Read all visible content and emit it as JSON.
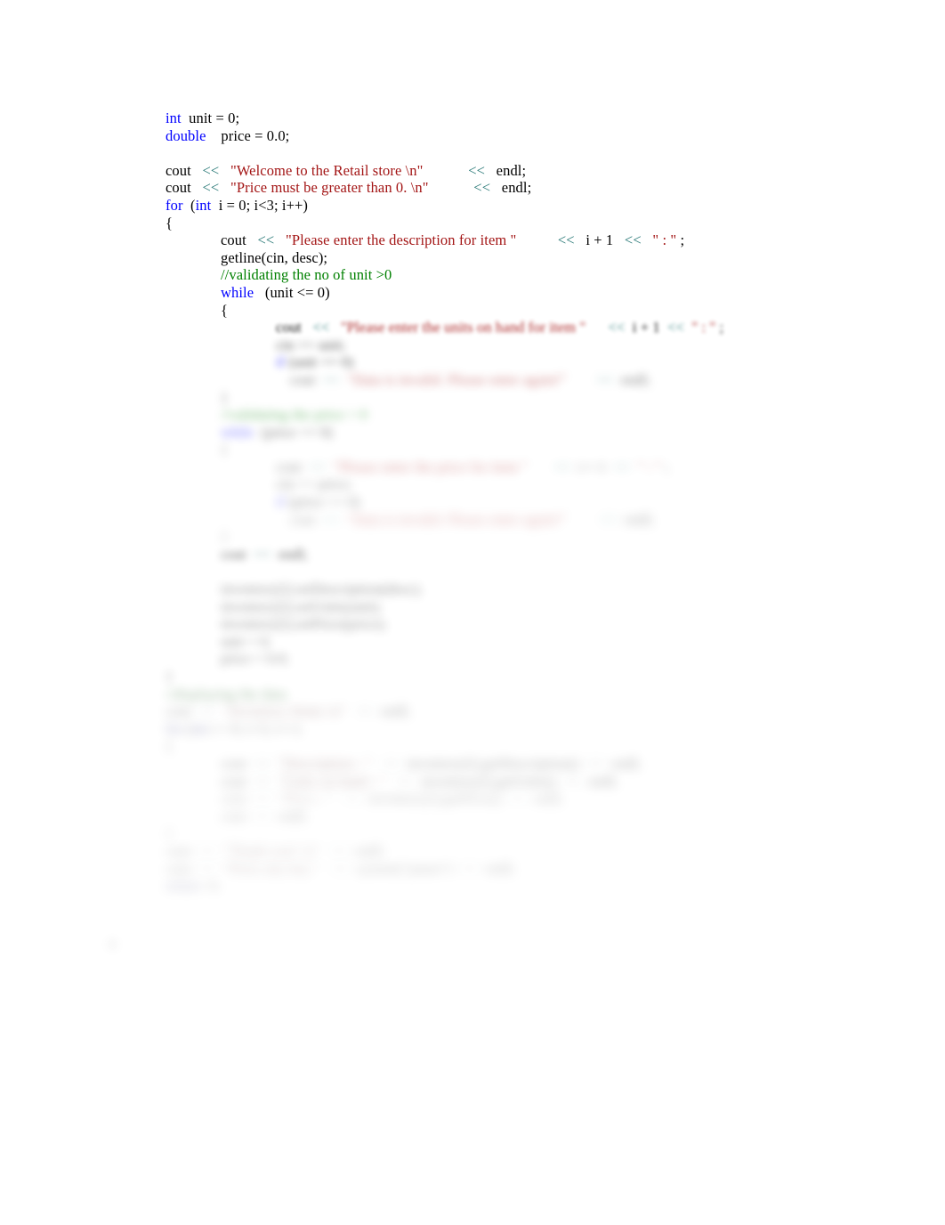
{
  "document": {
    "kind": "source-code-listing",
    "language": "C++",
    "page_background": "#ffffff",
    "margin_mark": "[]"
  },
  "palette": {
    "keyword": "#0000ff",
    "string": "#a31515",
    "comment": "#008000",
    "operator": "#2b7a78",
    "plain": "#000000",
    "background": "#ffffff"
  },
  "code": {
    "lines": [
      {
        "id": "l1",
        "indent": 0,
        "blur": "b0",
        "tokens": [
          {
            "t": "int",
            "c": "kw"
          },
          {
            "t": "  unit = 0;",
            "c": "pln"
          }
        ]
      },
      {
        "id": "l2",
        "indent": 0,
        "blur": "b0",
        "tokens": [
          {
            "t": "double",
            "c": "kw"
          },
          {
            "t": "    price = 0.0;",
            "c": "pln"
          }
        ]
      },
      {
        "id": "l3",
        "indent": 0,
        "blur": "b0",
        "tokens": []
      },
      {
        "id": "l4",
        "indent": 0,
        "blur": "b0",
        "tokens": [
          {
            "t": "cout   ",
            "c": "pln"
          },
          {
            "t": "<<",
            "c": "op"
          },
          {
            "t": "   ",
            "c": "pln"
          },
          {
            "t": "\"Welcome to the Retail store \\n\"",
            "c": "str"
          },
          {
            "t": "            ",
            "c": "pln"
          },
          {
            "t": "<<",
            "c": "op"
          },
          {
            "t": "   endl;",
            "c": "pln"
          }
        ]
      },
      {
        "id": "l5",
        "indent": 0,
        "blur": "b0",
        "tokens": [
          {
            "t": "cout   ",
            "c": "pln"
          },
          {
            "t": "<<",
            "c": "op"
          },
          {
            "t": "   ",
            "c": "pln"
          },
          {
            "t": "\"Price must be greater than 0. \\n\"",
            "c": "str"
          },
          {
            "t": "            ",
            "c": "pln"
          },
          {
            "t": "<<",
            "c": "op"
          },
          {
            "t": "   endl;",
            "c": "pln"
          }
        ]
      },
      {
        "id": "l6",
        "indent": 0,
        "blur": "b0",
        "tokens": [
          {
            "t": "for",
            "c": "kw"
          },
          {
            "t": "  (",
            "c": "pln"
          },
          {
            "t": "int",
            "c": "kw"
          },
          {
            "t": "  i = 0; i<3; i++)",
            "c": "pln"
          }
        ]
      },
      {
        "id": "l7",
        "indent": 0,
        "blur": "b0",
        "tokens": [
          {
            "t": "{",
            "c": "pln"
          }
        ]
      },
      {
        "id": "l8",
        "indent": 4,
        "blur": "b0",
        "tokens": [
          {
            "t": "cout   ",
            "c": "pln"
          },
          {
            "t": "<<",
            "c": "op"
          },
          {
            "t": "   ",
            "c": "pln"
          },
          {
            "t": "\"Please enter the description for item \"",
            "c": "str"
          },
          {
            "t": "           ",
            "c": "pln"
          },
          {
            "t": "<<",
            "c": "op"
          },
          {
            "t": "   i + 1   ",
            "c": "pln"
          },
          {
            "t": "<<",
            "c": "op"
          },
          {
            "t": "   ",
            "c": "pln"
          },
          {
            "t": "\" : \"",
            "c": "str"
          },
          {
            "t": " ;",
            "c": "pln"
          }
        ]
      },
      {
        "id": "l9",
        "indent": 4,
        "blur": "b0",
        "tokens": [
          {
            "t": "getline(cin, desc);",
            "c": "pln"
          }
        ]
      },
      {
        "id": "l10",
        "indent": 4,
        "blur": "b0",
        "tokens": [
          {
            "t": "//validating the no of unit >0",
            "c": "cmt"
          }
        ]
      },
      {
        "id": "l11",
        "indent": 4,
        "blur": "b0",
        "tokens": [
          {
            "t": "while",
            "c": "kw"
          },
          {
            "t": "   (unit <= 0)",
            "c": "pln"
          }
        ]
      },
      {
        "id": "l12",
        "indent": 4,
        "blur": "b0",
        "tokens": [
          {
            "t": "{",
            "c": "pln"
          }
        ]
      },
      {
        "id": "l13",
        "indent": 8,
        "blur": "b1",
        "tokens": [
          {
            "t": "cout   ",
            "c": "pln"
          },
          {
            "t": "<<",
            "c": "op"
          },
          {
            "t": "   ",
            "c": "pln"
          },
          {
            "t": "\"Please enter the units on hand for item \"",
            "c": "str"
          },
          {
            "t": "      ",
            "c": "pln"
          },
          {
            "t": "<<",
            "c": "op"
          },
          {
            "t": "  i + 1  ",
            "c": "pln"
          },
          {
            "t": "<<",
            "c": "op"
          },
          {
            "t": "  ",
            "c": "pln"
          },
          {
            "t": "\" : \"",
            "c": "str"
          },
          {
            "t": " ;",
            "c": "pln"
          }
        ]
      },
      {
        "id": "l14",
        "indent": 8,
        "blur": "b3",
        "tokens": [
          {
            "t": "cin >> unit;",
            "c": "pln"
          }
        ]
      },
      {
        "id": "l15",
        "indent": 8,
        "blur": "b3",
        "tokens": [
          {
            "t": "if",
            "c": "kw"
          },
          {
            "t": " (unit <= 0)",
            "c": "pln"
          }
        ]
      },
      {
        "id": "l16",
        "indent": 9,
        "blur": "b4",
        "tokens": [
          {
            "t": "cout  ",
            "c": "pln"
          },
          {
            "t": "<<",
            "c": "op"
          },
          {
            "t": "  ",
            "c": "pln"
          },
          {
            "t": "\"Data is invalid. Please enter again!\"",
            "c": "str"
          },
          {
            "t": "        ",
            "c": "pln"
          },
          {
            "t": "<<",
            "c": "op"
          },
          {
            "t": "  endl;",
            "c": "pln"
          }
        ]
      },
      {
        "id": "l17",
        "indent": 4,
        "blur": "b4",
        "tokens": [
          {
            "t": "}",
            "c": "pln"
          }
        ]
      },
      {
        "id": "l18",
        "indent": 4,
        "blur": "b4",
        "tokens": [
          {
            "t": "//validating the price > 0",
            "c": "cmt"
          }
        ]
      },
      {
        "id": "l19",
        "indent": 4,
        "blur": "b4",
        "tokens": [
          {
            "t": "while",
            "c": "kw"
          },
          {
            "t": "  (price <= 0)",
            "c": "pln"
          }
        ]
      },
      {
        "id": "l20",
        "indent": 4,
        "blur": "b5",
        "tokens": [
          {
            "t": "{",
            "c": "pln"
          }
        ]
      },
      {
        "id": "l21",
        "indent": 8,
        "blur": "b5",
        "tokens": [
          {
            "t": "cout  ",
            "c": "pln"
          },
          {
            "t": "<<",
            "c": "op"
          },
          {
            "t": "  ",
            "c": "pln"
          },
          {
            "t": "\"Please enter the price for item \"",
            "c": "str"
          },
          {
            "t": "       ",
            "c": "pln"
          },
          {
            "t": "<<",
            "c": "op"
          },
          {
            "t": "  i + 1  ",
            "c": "pln"
          },
          {
            "t": "<<",
            "c": "op"
          },
          {
            "t": "  ",
            "c": "pln"
          },
          {
            "t": "\" : \"",
            "c": "str"
          },
          {
            "t": " ;",
            "c": "pln"
          }
        ]
      },
      {
        "id": "l22",
        "indent": 8,
        "blur": "b5",
        "tokens": [
          {
            "t": "cin >> price;",
            "c": "pln"
          }
        ]
      },
      {
        "id": "l23",
        "indent": 8,
        "blur": "b5",
        "tokens": [
          {
            "t": "if",
            "c": "kw"
          },
          {
            "t": " (price <= 0)",
            "c": "pln"
          }
        ]
      },
      {
        "id": "l24",
        "indent": 9,
        "blur": "b6",
        "tokens": [
          {
            "t": "cout  ",
            "c": "pln"
          },
          {
            "t": "<<",
            "c": "op"
          },
          {
            "t": "  ",
            "c": "pln"
          },
          {
            "t": "\"Data is invalid. Please enter again!\"",
            "c": "str"
          },
          {
            "t": "         ",
            "c": "pln"
          },
          {
            "t": "<<",
            "c": "op"
          },
          {
            "t": "  endl;",
            "c": "pln"
          }
        ]
      },
      {
        "id": "l25",
        "indent": 4,
        "blur": "b6",
        "tokens": [
          {
            "t": "}",
            "c": "pln"
          }
        ]
      },
      {
        "id": "l26",
        "indent": 4,
        "blur": "g2",
        "tokens": [
          {
            "t": "cout  ",
            "c": "pln"
          },
          {
            "t": "<<",
            "c": "op"
          },
          {
            "t": "  endl;",
            "c": "pln"
          }
        ]
      },
      {
        "id": "l27",
        "indent": 0,
        "blur": "g2",
        "tokens": []
      },
      {
        "id": "l28",
        "indent": 4,
        "blur": "g3",
        "tokens": [
          {
            "t": "inventory[i].setDescription(desc);",
            "c": "pln"
          }
        ]
      },
      {
        "id": "l29",
        "indent": 4,
        "blur": "g3",
        "tokens": [
          {
            "t": "inventory[i].setUnits(unit);",
            "c": "pln"
          }
        ]
      },
      {
        "id": "l30",
        "indent": 4,
        "blur": "g3",
        "tokens": [
          {
            "t": "inventory[i].setPrice(price);",
            "c": "pln"
          }
        ]
      },
      {
        "id": "l31",
        "indent": 4,
        "blur": "g3",
        "tokens": [
          {
            "t": "unit = 0;",
            "c": "pln"
          }
        ]
      },
      {
        "id": "l32",
        "indent": 4,
        "blur": "g3",
        "tokens": [
          {
            "t": "price = 0.0;",
            "c": "pln"
          }
        ]
      },
      {
        "id": "l33",
        "indent": 0,
        "blur": "g3",
        "tokens": [
          {
            "t": "}",
            "c": "pln"
          }
        ]
      },
      {
        "id": "l34",
        "indent": 0,
        "blur": "g3",
        "tokens": [
          {
            "t": "//displaying the data",
            "c": "cmt"
          }
        ]
      },
      {
        "id": "l35",
        "indent": 0,
        "blur": "g4",
        "tokens": [
          {
            "t": "cout  ",
            "c": "pln"
          },
          {
            "t": "<<",
            "c": "op"
          },
          {
            "t": "  ",
            "c": "pln"
          },
          {
            "t": "\"Inventory Items \\n\"",
            "c": "str"
          },
          {
            "t": "   ",
            "c": "pln"
          },
          {
            "t": "<<",
            "c": "op"
          },
          {
            "t": "  endl;",
            "c": "pln"
          }
        ]
      },
      {
        "id": "l36",
        "indent": 0,
        "blur": "g4",
        "tokens": [
          {
            "t": "for",
            "c": "kw"
          },
          {
            "t": " (",
            "c": "pln"
          },
          {
            "t": "int",
            "c": "kw"
          },
          {
            "t": " i = 0; i<3; i++)",
            "c": "pln"
          }
        ]
      },
      {
        "id": "l37",
        "indent": 0,
        "blur": "g4",
        "tokens": [
          {
            "t": "{",
            "c": "pln"
          }
        ]
      },
      {
        "id": "l38",
        "indent": 4,
        "blur": "g4",
        "tokens": [
          {
            "t": "cout  ",
            "c": "pln"
          },
          {
            "t": "<<",
            "c": "op"
          },
          {
            "t": "  ",
            "c": "pln"
          },
          {
            "t": "\"Description : \"",
            "c": "str"
          },
          {
            "t": "   ",
            "c": "pln"
          },
          {
            "t": "<<",
            "c": "op"
          },
          {
            "t": "  inventory[i].getDescription()",
            "c": "pln"
          },
          {
            "t": "  ",
            "c": "pln"
          },
          {
            "t": "<<",
            "c": "op"
          },
          {
            "t": "  endl;",
            "c": "pln"
          }
        ]
      },
      {
        "id": "l39",
        "indent": 4,
        "blur": "g4",
        "tokens": [
          {
            "t": "cout  ",
            "c": "pln"
          },
          {
            "t": "<<",
            "c": "op"
          },
          {
            "t": "  ",
            "c": "pln"
          },
          {
            "t": "\"Units on hand : \"",
            "c": "str"
          },
          {
            "t": "   ",
            "c": "pln"
          },
          {
            "t": "<<",
            "c": "op"
          },
          {
            "t": "  inventory[i].getUnits()",
            "c": "pln"
          },
          {
            "t": "  ",
            "c": "pln"
          },
          {
            "t": "<<",
            "c": "op"
          },
          {
            "t": "  endl;",
            "c": "pln"
          }
        ]
      },
      {
        "id": "l40",
        "indent": 4,
        "blur": "g5",
        "tokens": [
          {
            "t": "cout  ",
            "c": "pln"
          },
          {
            "t": "<<",
            "c": "op"
          },
          {
            "t": "  ",
            "c": "pln"
          },
          {
            "t": "\"Price : \"",
            "c": "str"
          },
          {
            "t": "   ",
            "c": "pln"
          },
          {
            "t": "<<",
            "c": "op"
          },
          {
            "t": "  inventory[i].getPrice()",
            "c": "pln"
          },
          {
            "t": "  ",
            "c": "pln"
          },
          {
            "t": "<<",
            "c": "op"
          },
          {
            "t": "  endl;",
            "c": "pln"
          }
        ]
      },
      {
        "id": "l41",
        "indent": 4,
        "blur": "g5",
        "tokens": [
          {
            "t": "cout  ",
            "c": "pln"
          },
          {
            "t": "<<",
            "c": "op"
          },
          {
            "t": "  endl;",
            "c": "pln"
          }
        ]
      },
      {
        "id": "l42",
        "indent": 0,
        "blur": "g5",
        "tokens": [
          {
            "t": "}",
            "c": "pln"
          }
        ]
      },
      {
        "id": "l43",
        "indent": 0,
        "blur": "g5",
        "tokens": [
          {
            "t": "cout  ",
            "c": "pln"
          },
          {
            "t": "<<",
            "c": "op"
          },
          {
            "t": "  ",
            "c": "pln"
          },
          {
            "t": "\"Thank you! \\n\"",
            "c": "str"
          },
          {
            "t": "   ",
            "c": "pln"
          },
          {
            "t": "<<",
            "c": "op"
          },
          {
            "t": "  endl;",
            "c": "pln"
          }
        ]
      },
      {
        "id": "l44",
        "indent": 0,
        "blur": "g5",
        "tokens": [
          {
            "t": "cout  ",
            "c": "pln"
          },
          {
            "t": "<<",
            "c": "op"
          },
          {
            "t": "  ",
            "c": "pln"
          },
          {
            "t": "\"Press any key \"",
            "c": "str"
          },
          {
            "t": "   ",
            "c": "pln"
          },
          {
            "t": "<<",
            "c": "op"
          },
          {
            "t": "  system(\"pause\")  ",
            "c": "pln"
          },
          {
            "t": "<<",
            "c": "op"
          },
          {
            "t": "  endl;",
            "c": "pln"
          }
        ]
      },
      {
        "id": "l45",
        "indent": 0,
        "blur": "g5",
        "tokens": [
          {
            "t": "return",
            "c": "kw"
          },
          {
            "t": "  0;",
            "c": "pln"
          }
        ]
      }
    ]
  }
}
